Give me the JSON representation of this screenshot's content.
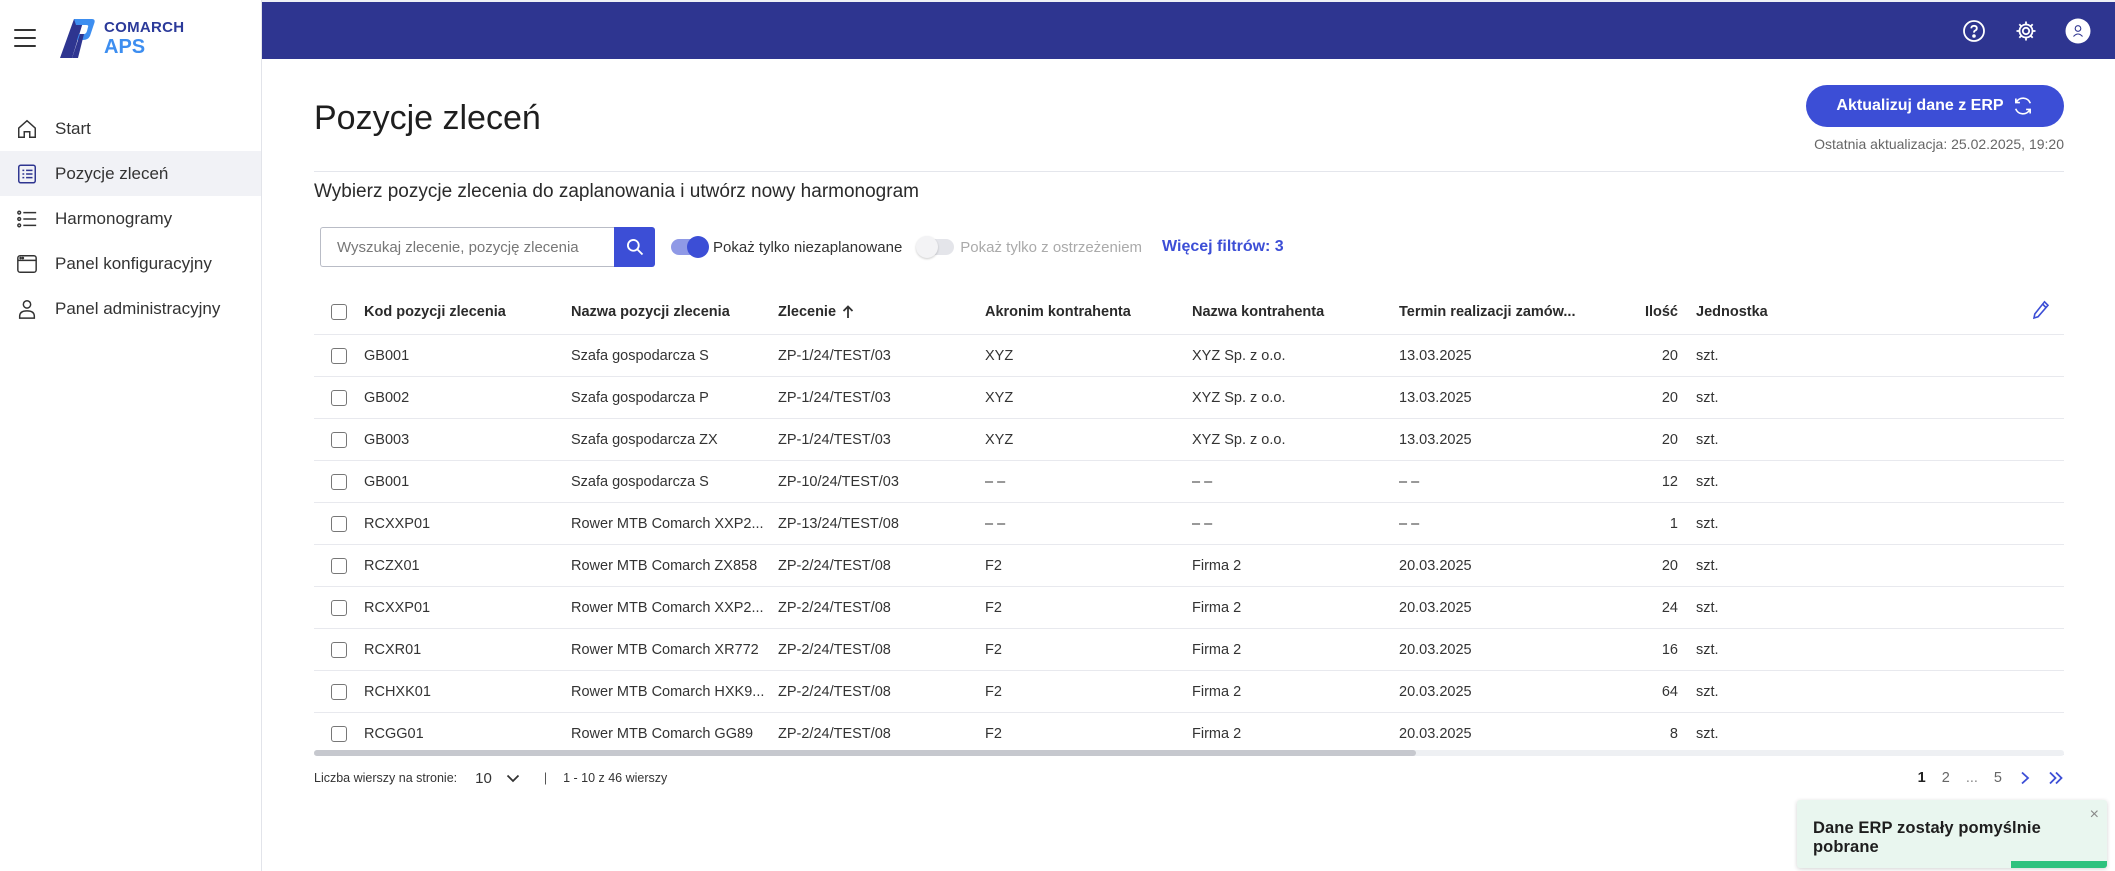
{
  "brand": {
    "line1": "COMARCH",
    "line2": "APS",
    "color_primary": "#2e3590",
    "color_accent": "#3c4ed6",
    "color_logo_light": "#3d8ef0"
  },
  "nav": {
    "items": [
      {
        "label": "Start",
        "icon": "home-icon"
      },
      {
        "label": "Pozycje zleceń",
        "icon": "list-icon",
        "active": true
      },
      {
        "label": "Harmonogramy",
        "icon": "bullet-list-icon"
      },
      {
        "label": "Panel konfiguracyjny",
        "icon": "window-icon"
      },
      {
        "label": "Panel administracyjny",
        "icon": "user-icon"
      }
    ]
  },
  "topbar": {
    "icons": [
      "help-icon",
      "gear-icon",
      "avatar-icon"
    ]
  },
  "page": {
    "title": "Pozycje zleceń",
    "erp_button": "Aktualizuj dane z ERP",
    "last_update": "Ostatnia aktualizacja: 25.02.2025, 19:20",
    "subtitle": "Wybierz pozycje zlecenia do zaplanowania i utwórz nowy harmonogram"
  },
  "filters": {
    "search_placeholder": "Wyszukaj zlecenie, pozycję zlecenia",
    "toggle_unplanned": {
      "label": "Pokaż tylko niezaplanowane",
      "on": true
    },
    "toggle_warnings": {
      "label": "Pokaż tylko z ostrzeżeniem",
      "on": false
    },
    "more_filters": "Więcej filtrów: 3"
  },
  "table": {
    "columns": [
      "Kod pozycji zlecenia",
      "Nazwa pozycji zlecenia",
      "Zlecenie",
      "Akronim kontrahenta",
      "Nazwa kontrahenta",
      "Termin realizacji zamów...",
      "Ilość",
      "Jednostka"
    ],
    "sort": {
      "column": "Zlecenie",
      "direction": "asc"
    },
    "rows": [
      {
        "kod": "GB001",
        "nazwa": "Szafa gospodarcza S",
        "zlecenie": "ZP-1/24/TEST/03",
        "akronim": "XYZ",
        "kontrahent": "XYZ Sp. z o.o.",
        "termin": "13.03.2025",
        "ilosc": "20",
        "jednostka": "szt."
      },
      {
        "kod": "GB002",
        "nazwa": "Szafa gospodarcza P",
        "zlecenie": "ZP-1/24/TEST/03",
        "akronim": "XYZ",
        "kontrahent": "XYZ Sp. z o.o.",
        "termin": "13.03.2025",
        "ilosc": "20",
        "jednostka": "szt."
      },
      {
        "kod": "GB003",
        "nazwa": "Szafa gospodarcza ZX",
        "zlecenie": "ZP-1/24/TEST/03",
        "akronim": "XYZ",
        "kontrahent": "XYZ Sp. z o.o.",
        "termin": "13.03.2025",
        "ilosc": "20",
        "jednostka": "szt."
      },
      {
        "kod": "GB001",
        "nazwa": "Szafa gospodarcza S",
        "zlecenie": "ZP-10/24/TEST/03",
        "akronim": "– –",
        "kontrahent": "– –",
        "termin": "– –",
        "ilosc": "12",
        "jednostka": "szt."
      },
      {
        "kod": "RCXXP01",
        "nazwa": "Rower MTB Comarch XXP2...",
        "zlecenie": "ZP-13/24/TEST/08",
        "akronim": "– –",
        "kontrahent": "– –",
        "termin": "– –",
        "ilosc": "1",
        "jednostka": "szt."
      },
      {
        "kod": "RCZX01",
        "nazwa": "Rower MTB Comarch ZX858",
        "zlecenie": "ZP-2/24/TEST/08",
        "akronim": "F2",
        "kontrahent": "Firma 2",
        "termin": "20.03.2025",
        "ilosc": "20",
        "jednostka": "szt."
      },
      {
        "kod": "RCXXP01",
        "nazwa": "Rower MTB Comarch XXP2...",
        "zlecenie": "ZP-2/24/TEST/08",
        "akronim": "F2",
        "kontrahent": "Firma 2",
        "termin": "20.03.2025",
        "ilosc": "24",
        "jednostka": "szt."
      },
      {
        "kod": "RCXR01",
        "nazwa": "Rower MTB Comarch XR772",
        "zlecenie": "ZP-2/24/TEST/08",
        "akronim": "F2",
        "kontrahent": "Firma 2",
        "termin": "20.03.2025",
        "ilosc": "16",
        "jednostka": "szt."
      },
      {
        "kod": "RCHXK01",
        "nazwa": "Rower MTB Comarch HXK9...",
        "zlecenie": "ZP-2/24/TEST/08",
        "akronim": "F2",
        "kontrahent": "Firma 2",
        "termin": "20.03.2025",
        "ilosc": "64",
        "jednostka": "szt."
      },
      {
        "kod": "RCGG01",
        "nazwa": "Rower MTB Comarch GG89",
        "zlecenie": "ZP-2/24/TEST/08",
        "akronim": "F2",
        "kontrahent": "Firma 2",
        "termin": "20.03.2025",
        "ilosc": "8",
        "jednostka": "szt."
      }
    ]
  },
  "pagination": {
    "rows_label": "Liczba wierszy na stronie:",
    "rows_value": "10",
    "separator": "|",
    "range": "1 - 10 z 46 wierszy",
    "pages": [
      "1",
      "2"
    ],
    "ellipsis": "...",
    "last_page": "5",
    "current": "1"
  },
  "toast": {
    "message": "Dane ERP zostały pomyślnie pobrane",
    "close": "×",
    "color": "#2ec27e"
  }
}
